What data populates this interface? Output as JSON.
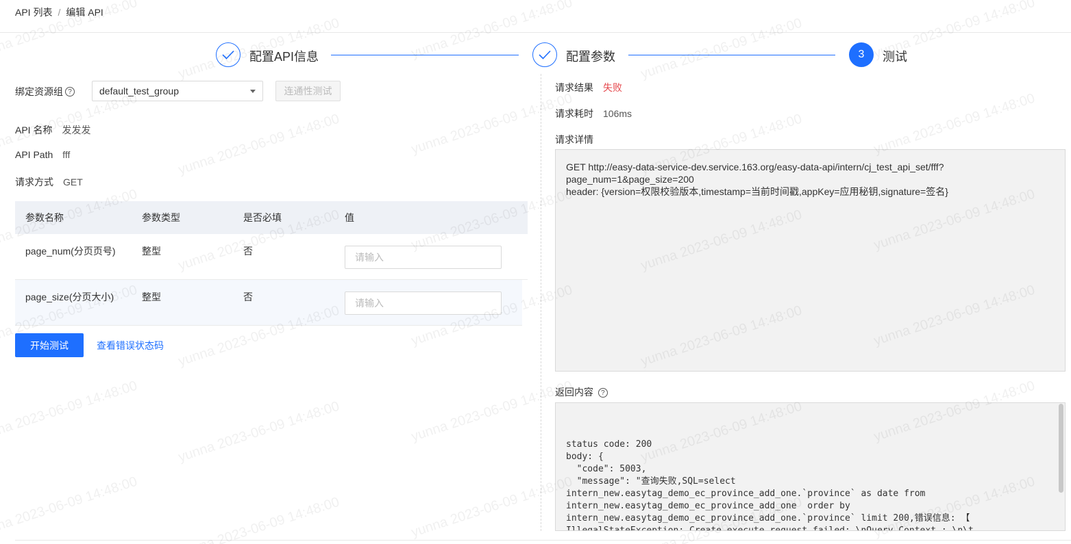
{
  "breadcrumb": {
    "parent": "API 列表",
    "separator": "/",
    "current": "编辑 API"
  },
  "steps": [
    {
      "label": "配置API信息",
      "state": "done",
      "number": "1"
    },
    {
      "label": "配置参数",
      "state": "done",
      "number": "2"
    },
    {
      "label": "测试",
      "state": "active",
      "number": "3"
    }
  ],
  "left": {
    "resource_group_label": "绑定资源组",
    "resource_group_value": "default_test_group",
    "connectivity_button": "连通性测试",
    "api_name_label": "API 名称",
    "api_name_value": "发发发",
    "api_path_label": "API Path",
    "api_path_value": "fff",
    "method_label": "请求方式",
    "method_value": "GET",
    "table": {
      "headers": [
        "参数名称",
        "参数类型",
        "是否必填",
        "值"
      ],
      "rows": [
        {
          "name": "page_num(分页页号)",
          "type": "整型",
          "required": "否",
          "placeholder": "请输入"
        },
        {
          "name": "page_size(分页大小)",
          "type": "整型",
          "required": "否",
          "placeholder": "请输入"
        }
      ]
    },
    "start_button": "开始测试",
    "error_codes_link": "查看错误状态码"
  },
  "right": {
    "result_label": "请求结果",
    "result_value": "失败",
    "duration_label": "请求耗时",
    "duration_value": "106ms",
    "detail_label": "请求详情",
    "detail_text": "GET http://easy-data-service-dev.service.163.org/easy-data-api/intern/cj_test_api_set/fff?\npage_num=1&page_size=200\nheader: {version=权限校验版本,timestamp=当前时间戳,appKey=应用秘钥,signature=签名}",
    "response_label": "返回内容",
    "response_text": "status code: 200\nbody: {\n  \"code\": 5003,\n  \"message\": \"查询失败,SQL=select\nintern_new.easytag_demo_ec_province_add_one.`province` as date from\nintern_new.easytag_demo_ec_province_add_one  order by\nintern_new.easytag_demo_ec_province_add_one.`province` limit 200,错误信息: 【\nIllegalStateException: Create execute request failed: \\nQuery Context : \\n\\t\nstatement : select  intern_new.easytag_demo_ec_province_add_one.`province` as date\nfrom intern_new.easytag_demo_ec_province_add_one  order by"
  },
  "watermark": "yunna 2023-06-09 14:48:00",
  "colors": {
    "primary": "#1e6fff",
    "fail": "#e5484d",
    "table_header": "#eef1f6"
  }
}
